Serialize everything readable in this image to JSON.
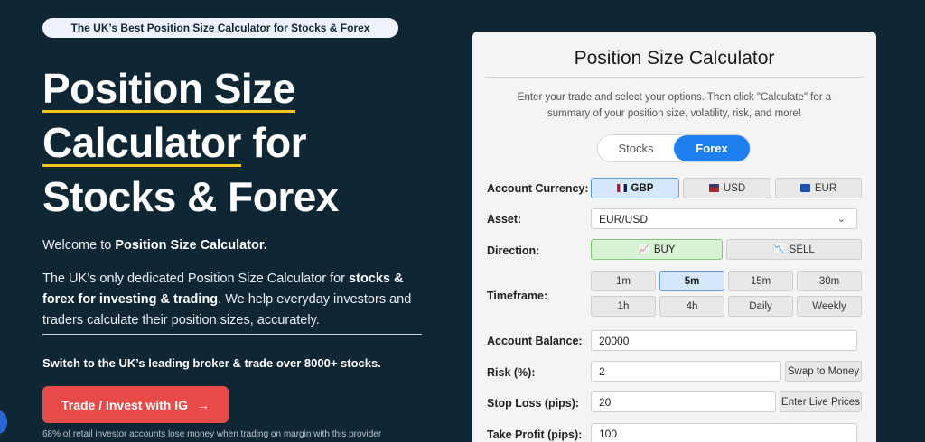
{
  "banner": "The UK’s Best Position Size Calculator for Stocks & Forex",
  "hero": {
    "line1": "Position Size",
    "line2_underlined": "Calculator",
    "line2_rest": " for",
    "line3": "Stocks & Forex"
  },
  "welcome": {
    "prefix": "Welcome to ",
    "name": "Position Size Calculator."
  },
  "intro": {
    "part1": "The UK’s only dedicated Position Size Calculator for ",
    "bold": "stocks & forex for investing & trading",
    "part2": ". We help everyday investors and traders calculate their position sizes, accurately."
  },
  "switch_text": "Switch to the UK’s leading broker & trade over 8000+ stocks.",
  "cta": {
    "label": "Trade / Invest with IG",
    "arrow": "→"
  },
  "disclaimer": "68% of retail investor accounts lose money when trading on margin with this provider",
  "calculator": {
    "title": "Position Size Calculator",
    "description": "Enter your trade and select your options. Then click \"Calculate\" for a summary of your position size, volatility, risk, and more!",
    "mode": {
      "stocks": "Stocks",
      "forex": "Forex",
      "selected": "Forex"
    },
    "labels": {
      "account_currency": "Account Currency:",
      "asset": "Asset:",
      "direction": "Direction:",
      "timeframe": "Timeframe:",
      "account_balance": "Account Balance:",
      "risk": "Risk (%):",
      "stop_loss": "Stop Loss (pips):",
      "take_profit": "Take Profit (pips):"
    },
    "currencies": [
      {
        "code": "GBP",
        "icon": "uk-flag-icon",
        "selected": true
      },
      {
        "code": "USD",
        "icon": "dollar-bill-icon",
        "selected": false
      },
      {
        "code": "EUR",
        "icon": "euro-bill-icon",
        "selected": false
      }
    ],
    "asset_value": "EUR/USD",
    "direction": {
      "buy": "BUY",
      "sell": "SELL",
      "selected": "BUY"
    },
    "timeframes": [
      "1m",
      "5m",
      "15m",
      "30m",
      "1h",
      "4h",
      "Daily",
      "Weekly"
    ],
    "timeframe_selected": "5m",
    "account_balance": "20000",
    "risk_value": "2",
    "swap_label": "Swap to Money",
    "stop_loss_value": "20",
    "live_prices_label": "Enter Live Prices",
    "take_profit_value": "100",
    "colors": {
      "accent": "#1e7ff0",
      "cta": "#e84a4a",
      "underline": "#f5c518",
      "background": "#0f2634"
    }
  }
}
